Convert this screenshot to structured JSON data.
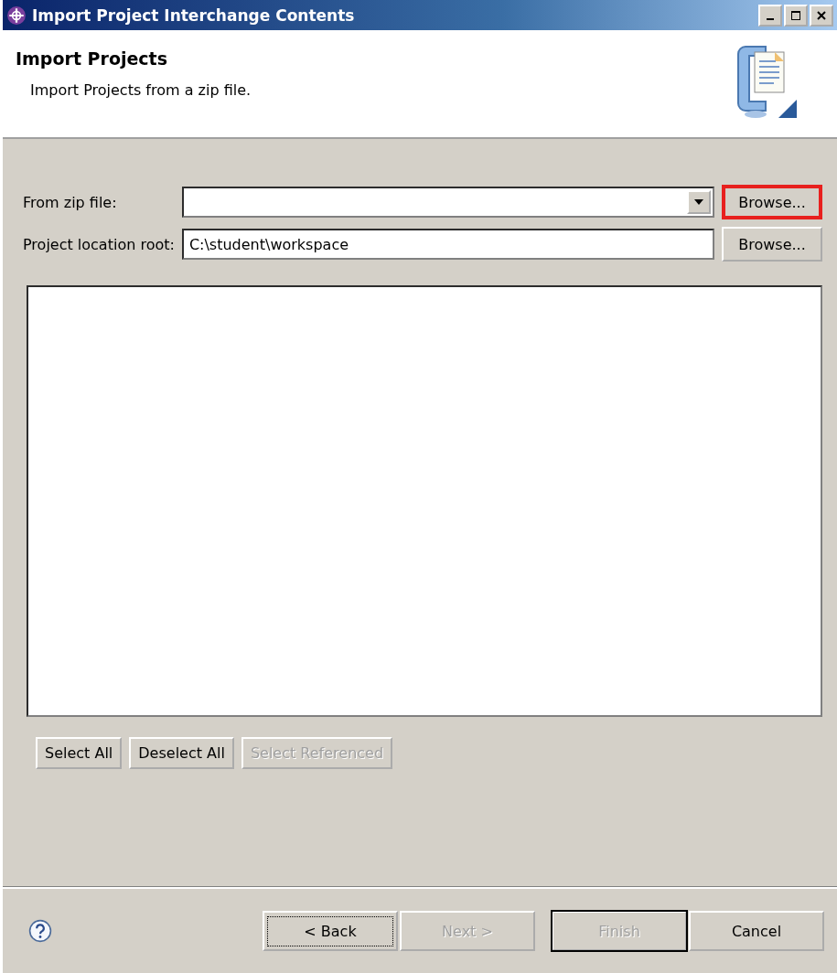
{
  "window": {
    "title": "Import Project Interchange Contents"
  },
  "header": {
    "title": "Import Projects",
    "description": "Import Projects from a zip file."
  },
  "fields": [
    {
      "kind": "combo",
      "label": "From zip file:",
      "button": {
        "label": "Browse...",
        "highlighted": true
      }
    },
    {
      "kind": "text",
      "label": "Project location root:",
      "value": "C:\\student\\workspace",
      "button": {
        "label": "Browse...",
        "highlighted": false
      }
    }
  ],
  "selection_buttons": [
    {
      "label": "Select All",
      "disabled": false
    },
    {
      "label": "Deselect All",
      "disabled": false
    },
    {
      "label": "Select Referenced",
      "disabled": true
    }
  ],
  "footer_buttons": [
    {
      "label": "< Back",
      "disabled": false,
      "focused": true,
      "default": false
    },
    {
      "label": "Next >",
      "disabled": true,
      "focused": false,
      "default": false
    },
    {
      "label": "Finish",
      "disabled": true,
      "focused": false,
      "default": true
    },
    {
      "label": "Cancel",
      "disabled": false,
      "focused": false,
      "default": false
    }
  ]
}
